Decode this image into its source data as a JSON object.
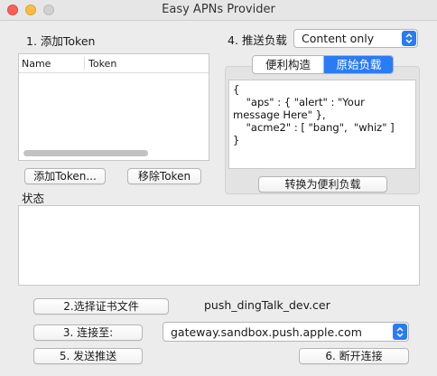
{
  "window": {
    "title": "Easy APNs Provider"
  },
  "sections": {
    "add_token": "1. 添加Token",
    "push_payload": "4. 推送负载",
    "status": "状态"
  },
  "token_table": {
    "columns": [
      "Name",
      "Token"
    ],
    "rows": []
  },
  "buttons": {
    "add_token": "添加Token...",
    "remove_token": "移除Token",
    "convert": "转换为便利负载",
    "choose_cert": "2.选择证书文件",
    "connect_to": "3. 连接至:",
    "send_push": "5. 发送推送",
    "disconnect": "6. 断开连接"
  },
  "payload_type": {
    "selected": "Content only"
  },
  "payload_tabs": [
    {
      "label": "便利构造",
      "selected": false
    },
    {
      "label": "原始负载",
      "selected": true
    }
  ],
  "payload_text": "{\n    \"aps\" : { \"alert\" : \"Your message Here\" },\n    \"acme2\" : [ \"bang\",  \"whiz\" ]\n}",
  "certificate": {
    "filename": "push_dingTalk_dev.cer"
  },
  "gateway": {
    "selected": "gateway.sandbox.push.apple.com"
  },
  "colors": {
    "accent": "#2a7bf6",
    "close": "#fc605b",
    "minimize": "#fdbc40"
  },
  "icons": {
    "dropdown": "up-down-chevron-icon"
  }
}
